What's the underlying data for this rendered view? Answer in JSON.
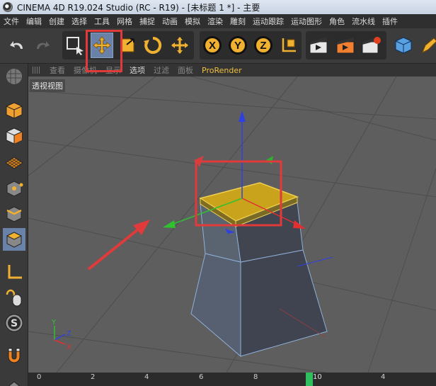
{
  "window": {
    "title": "CINEMA 4D R19.024 Studio (RC - R19) - [未标题 1 *] - 主要"
  },
  "menubar": {
    "items": [
      "文件",
      "编辑",
      "创建",
      "选择",
      "工具",
      "网格",
      "捕捉",
      "动画",
      "模拟",
      "渲染",
      "雕刻",
      "运动跟踪",
      "运动图形",
      "角色",
      "流水线",
      "插件"
    ]
  },
  "toolbar": {
    "axis_x": "X",
    "axis_y": "Y",
    "axis_z": "Z"
  },
  "viewport": {
    "menu": [
      "查看",
      "摄像机",
      "显示",
      "选项",
      "过滤",
      "面板",
      "ProRender"
    ],
    "label": "透视视图",
    "axis_y": "Y",
    "axis_z": "Z",
    "axis_x": "X"
  },
  "timeline": {
    "ticks": [
      "0",
      "2",
      "4",
      "6",
      "8",
      "4"
    ],
    "current_frame": "10"
  },
  "colors": {
    "accent": "#6a82a8",
    "selection": "#e03a3a",
    "polygon": "#d8b020"
  }
}
